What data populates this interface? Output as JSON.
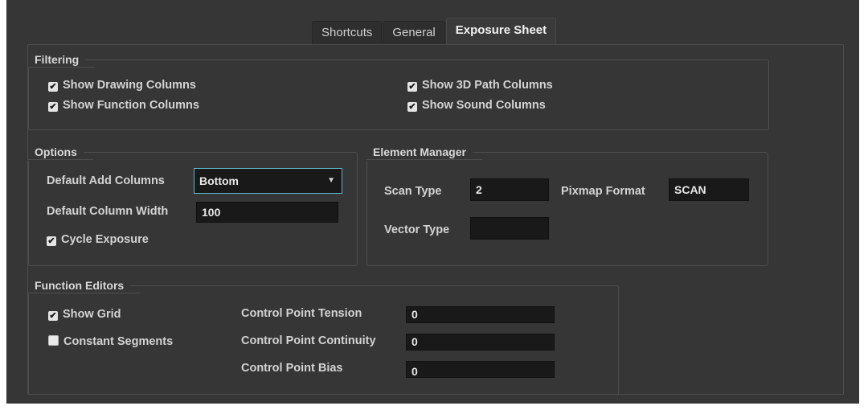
{
  "tabs": [
    {
      "label": "Shortcuts",
      "active": false
    },
    {
      "label": "General",
      "active": false
    },
    {
      "label": "Exposure Sheet",
      "active": true
    }
  ],
  "filtering": {
    "title": "Filtering",
    "show_drawing_columns": {
      "label": "Show Drawing Columns",
      "checked": true
    },
    "show_function_columns": {
      "label": "Show Function Columns",
      "checked": true
    },
    "show_3d_path_columns": {
      "label": "Show 3D Path Columns",
      "checked": true
    },
    "show_sound_columns": {
      "label": "Show Sound Columns",
      "checked": true
    }
  },
  "options": {
    "title": "Options",
    "default_add_columns_label": "Default Add Columns",
    "default_add_columns_value": "Bottom",
    "default_column_width_label": "Default Column Width",
    "default_column_width_value": "100",
    "cycle_exposure": {
      "label": "Cycle Exposure",
      "checked": true
    }
  },
  "element_manager": {
    "title": "Element Manager",
    "scan_type_label": "Scan Type",
    "scan_type_value": "2",
    "pixmap_format_label": "Pixmap Format",
    "pixmap_format_value": "SCAN",
    "vector_type_label": "Vector Type",
    "vector_type_value": ""
  },
  "function_editors": {
    "title": "Function Editors",
    "show_grid": {
      "label": "Show Grid",
      "checked": true
    },
    "constant_segments": {
      "label": "Constant Segments",
      "checked": false
    },
    "tension_label": "Control Point Tension",
    "tension_value": "0",
    "continuity_label": "Control Point Continuity",
    "continuity_value": "0",
    "bias_label": "Control Point Bias",
    "bias_value": "0"
  },
  "icons": {
    "checkbox_checked": "check-icon",
    "dropdown": "chevron-down-icon"
  },
  "colors": {
    "background": "#363636",
    "field": "#191919",
    "focus_border": "#5fb7c7"
  }
}
